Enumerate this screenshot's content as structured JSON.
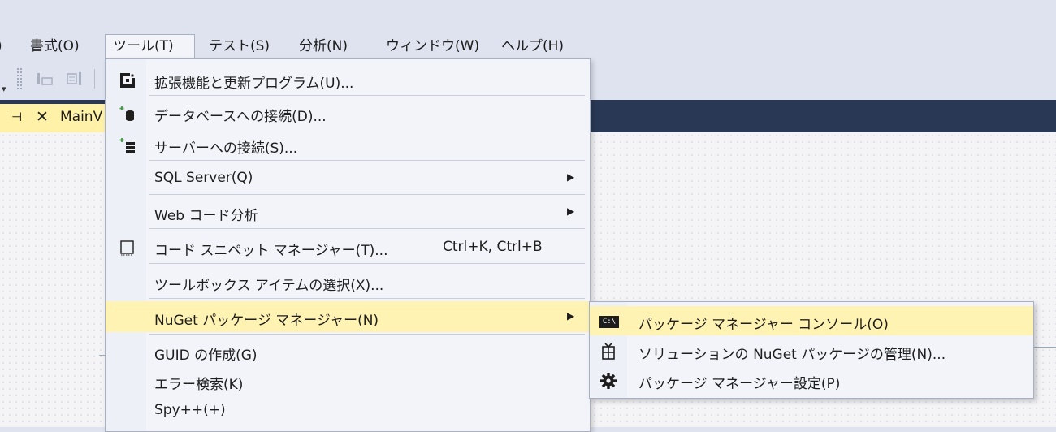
{
  "menubar": {
    "cut_item": ")",
    "items": [
      "書式(O)",
      "ツール(T)",
      "テスト(S)",
      "分析(N)",
      "ウィンドウ(W)",
      "ヘルプ(H)"
    ]
  },
  "tab": {
    "pin": "⊣",
    "close": "✕",
    "title": "MainV"
  },
  "tools_menu": {
    "items": [
      {
        "label": "拡張機能と更新プログラム(U)...",
        "icon": "extensions-icon"
      },
      {
        "label": "データベースへの接続(D)...",
        "icon": "database-connect-icon"
      },
      {
        "label": "サーバーへの接続(S)...",
        "icon": "server-connect-icon"
      },
      {
        "label": "SQL Server(Q)",
        "arrow": "▶"
      },
      {
        "label": "Web コード分析",
        "arrow": "▶"
      },
      {
        "label": "コード スニペット マネージャー(T)...",
        "icon": "snippet-icon",
        "shortcut": "Ctrl+K, Ctrl+B"
      },
      {
        "label": "ツールボックス アイテムの選択(X)..."
      },
      {
        "label": "NuGet パッケージ マネージャー(N)",
        "arrow": "▶"
      },
      {
        "label": "GUID の作成(G)"
      },
      {
        "label": "エラー検索(K)"
      },
      {
        "label": "Spy++(+)"
      }
    ]
  },
  "nuget_submenu": {
    "items": [
      {
        "label": "パッケージ マネージャー コンソール(O)",
        "icon": "console-icon",
        "icon_text": "C:\\"
      },
      {
        "label": "ソリューションの NuGet パッケージの管理(N)...",
        "icon": "package-icon"
      },
      {
        "label": "パッケージ マネージャー設定(P)",
        "icon": "gear-icon"
      }
    ]
  },
  "colors": {
    "highlight": "#fff3b3",
    "tabstrip": "#293955",
    "tab_active": "#fff1a8"
  }
}
